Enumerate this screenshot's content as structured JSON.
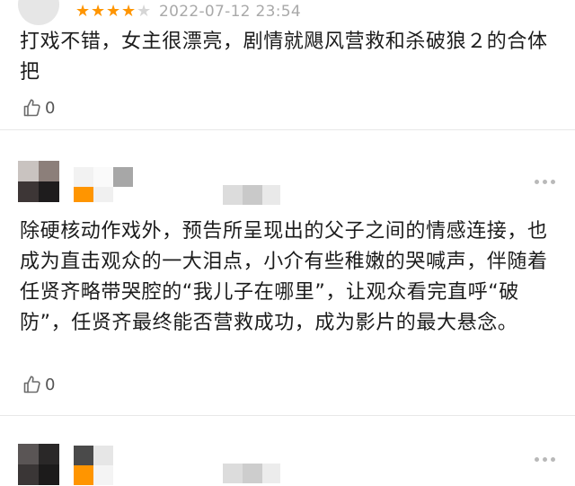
{
  "reviews": [
    {
      "timestamp": "2022-07-12 23:54",
      "rating": 4,
      "rating_max": 5,
      "text": "打戏不错，女主很漂亮，剧情就飓风营救和杀破狼２的合体把",
      "like_count": "0",
      "icons": {
        "like": "thumbs-up-icon"
      }
    },
    {
      "text": "除硬核动作戏外，预告所呈现出的父子之间的情感连接，也成为直击观众的一大泪点，小介有些稚嫩的哭喊声，伴随着任贤齐略带哭腔的“我儿子在哪里”，让观众看完直呼“破防”，任贤齐最终能否营救成功，成为影片的最大悬念。",
      "like_count": "0",
      "icons": {
        "like": "thumbs-up-icon",
        "more": "more-dots-icon"
      }
    },
    {
      "icons": {
        "more": "more-dots-icon"
      }
    }
  ],
  "colors": {
    "star_active": "#ff9500",
    "star_inactive": "#d6d6d6",
    "timestamp": "#a9a9a9",
    "text": "#1c1c1c",
    "badge_orange": "#ff9500"
  }
}
